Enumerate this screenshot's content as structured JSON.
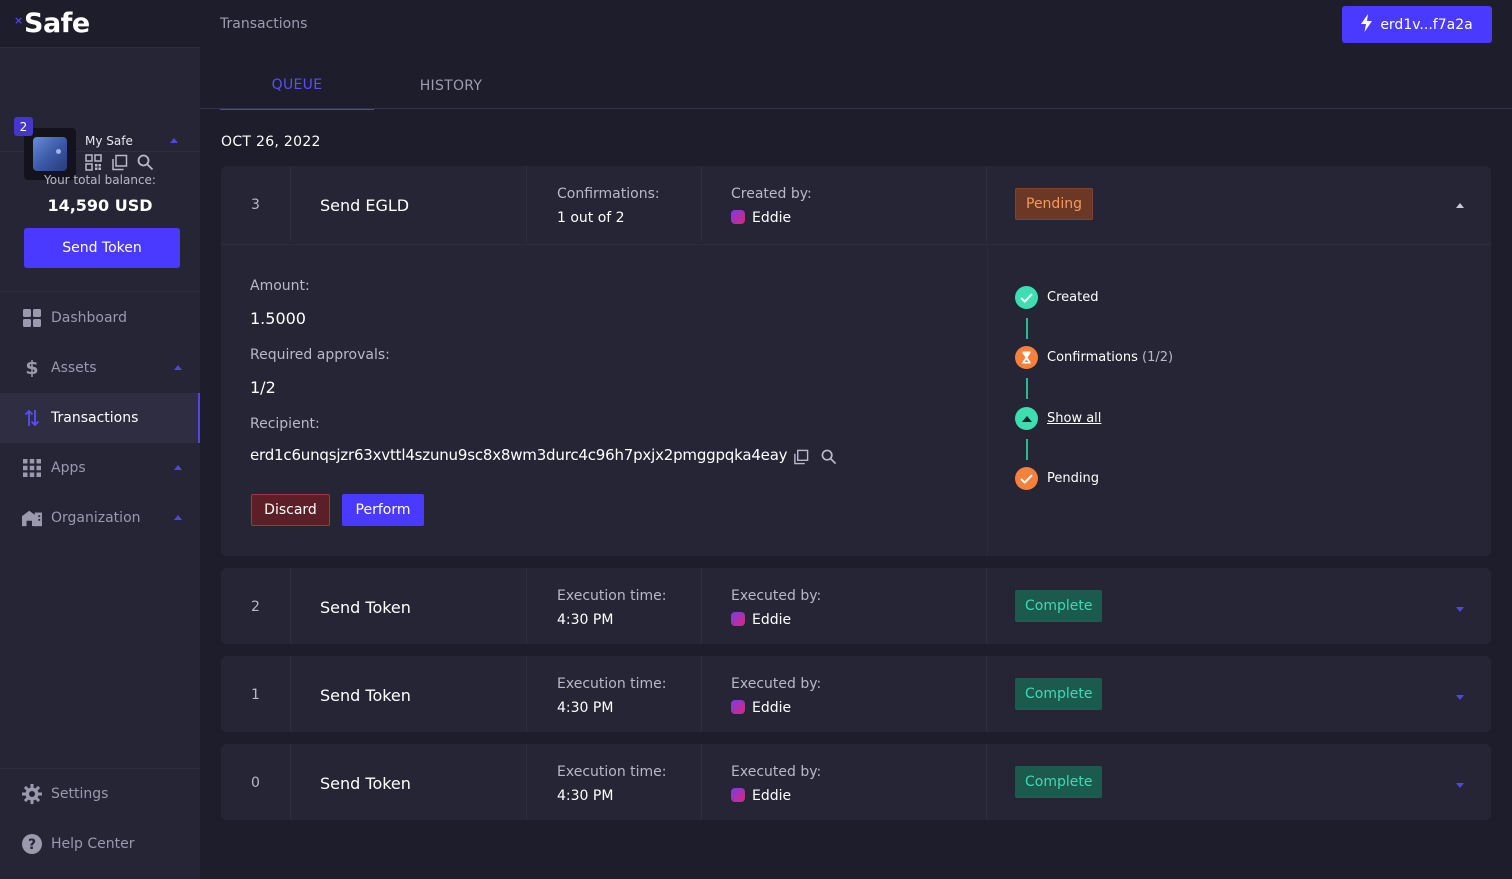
{
  "app": {
    "logo": "Safe",
    "logo_mark": "×",
    "page_title": "Transactions"
  },
  "wallet": {
    "address": "erd1v...f7a2a"
  },
  "safe": {
    "name": "My Safe",
    "owners_badge": "2"
  },
  "balance": {
    "label": "Your total balance:",
    "value": "14,590 USD",
    "send_label": "Send Token"
  },
  "nav": [
    {
      "label": "Dashboard",
      "icon": "dashboard-icon"
    },
    {
      "label": "Assets",
      "icon": "dollar-icon"
    },
    {
      "label": "Transactions",
      "icon": "transactions-icon"
    },
    {
      "label": "Apps",
      "icon": "apps-icon"
    },
    {
      "label": "Organization",
      "icon": "organization-icon"
    }
  ],
  "nav_bottom": [
    {
      "label": "Settings",
      "icon": "gear-icon"
    },
    {
      "label": "Help Center",
      "icon": "help-icon"
    }
  ],
  "tabs": [
    {
      "label": "QUEUE"
    },
    {
      "label": "HISTORY"
    }
  ],
  "date": "OCT 26, 2022",
  "expanded_tx": {
    "nonce": "3",
    "title": "Send EGLD",
    "col1_label": "Confirmations:",
    "col1_value": "1 out of 2",
    "col2_label": "Created by:",
    "col2_value": "Eddie",
    "status": "Pending",
    "amount_label": "Amount:",
    "amount_value": "1.5000",
    "approvals_label": "Required approvals:",
    "approvals_value": "1/2",
    "recipient_label": "Recipient:",
    "recipient_value": "erd1c6unqsjzr63xvttl4szunu9sc8x8wm3durc4c96h7pxjx2pmggpqka4eay",
    "discard_label": "Discard",
    "perform_label": "Perform",
    "timeline": [
      {
        "label": "Created",
        "sub": ""
      },
      {
        "label": "Confirmations",
        "sub": " (1/2)"
      },
      {
        "label": "Show all",
        "sub": ""
      },
      {
        "label": "Pending",
        "sub": ""
      }
    ]
  },
  "transactions": [
    {
      "nonce": "2",
      "title": "Send Token",
      "col1_label": "Execution time:",
      "col1_value": "4:30 PM",
      "col2_label": "Executed by:",
      "col2_value": "Eddie",
      "status": "Complete"
    },
    {
      "nonce": "1",
      "title": "Send Token",
      "col1_label": "Execution time:",
      "col1_value": "4:30 PM",
      "col2_label": "Executed by:",
      "col2_value": "Eddie",
      "status": "Complete"
    },
    {
      "nonce": "0",
      "title": "Send Token",
      "col1_label": "Execution time:",
      "col1_value": "4:30 PM",
      "col2_label": "Executed by:",
      "col2_value": "Eddie",
      "status": "Complete"
    }
  ],
  "colors": {
    "accent": "#4a3aff",
    "pending": "#f59a5a",
    "complete": "#41d9b5",
    "danger": "#a4343f"
  }
}
